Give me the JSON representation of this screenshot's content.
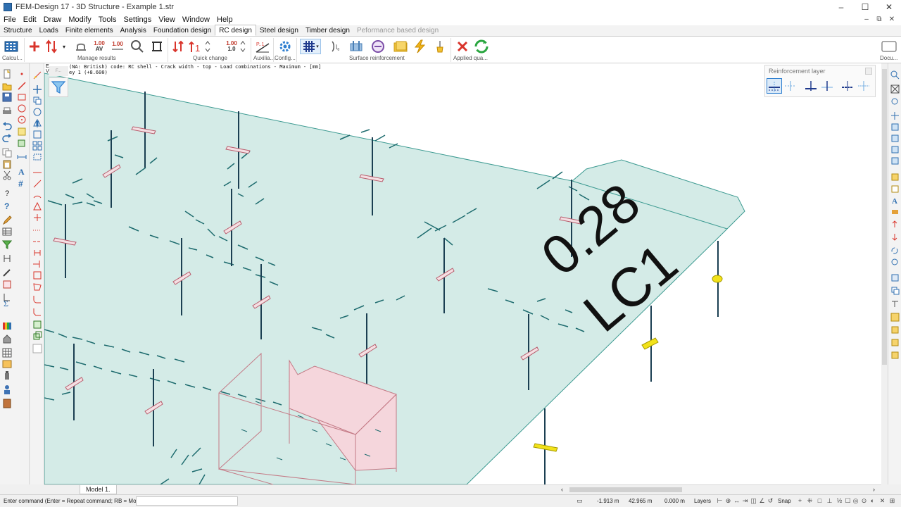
{
  "window": {
    "title": "FEM-Design 17 - 3D Structure - Example 1.str",
    "controls": [
      "–",
      "☐",
      "✕"
    ],
    "mdi_controls": [
      "–",
      "⧉",
      "✕"
    ]
  },
  "menu": [
    "File",
    "Edit",
    "Draw",
    "Modify",
    "Tools",
    "Settings",
    "View",
    "Window",
    "Help"
  ],
  "tabs": [
    {
      "label": "Structure",
      "state": "normal"
    },
    {
      "label": "Loads",
      "state": "normal"
    },
    {
      "label": "Finite elements",
      "state": "normal"
    },
    {
      "label": "Analysis",
      "state": "normal"
    },
    {
      "label": "Foundation design",
      "state": "normal"
    },
    {
      "label": "RC design",
      "state": "active"
    },
    {
      "label": "Steel design",
      "state": "normal"
    },
    {
      "label": "Timber design",
      "state": "normal"
    },
    {
      "label": "Peformance based design",
      "state": "disabled"
    }
  ],
  "ribbon": {
    "groups": [
      "Calcul...",
      "Manage results",
      "Quick change",
      "Auxilia...",
      "Config...",
      "Surface reinforcement",
      "Applied qua...",
      "Docu..."
    ],
    "labels": {
      "num_a": "1.00",
      "num_b": "1.00",
      "num_c": "1.00",
      "num_d": "1.00",
      "num_e": "1.0",
      "num_f": "1",
      "delta_ab": "AV",
      "p1": "P..1"
    }
  },
  "viewport": {
    "corner_letter_e": "E",
    "corner_letter_v": "V",
    "info_line1": "(NA: British) code: RC shell - Crack width - top - Load combinations - Maximum - [mm]",
    "info_line2": "ey 1 (+8.600)",
    "mini_tag": "F...",
    "result_value": "0.28",
    "result_case": "LC1",
    "colors": {
      "slab_fill": "#d4ebe7",
      "slab_edge": "#3c9a91",
      "column": "#1b3f52",
      "crack_dash": "#1d6b6e",
      "wall": "#c47a86",
      "wall_fill": "#f5d6dc",
      "support_yellow": "#f2e21a"
    }
  },
  "reinforcement_panel": {
    "title": "Reinforcement layer"
  },
  "model_tab": "Model 1.",
  "statusbar": {
    "command_prompt": "Enter command (Enter = Repeat command; RB = Modify):",
    "x": "-1.913 m",
    "y": "42.965 m",
    "z": "0.000 m",
    "layers": "Layers",
    "snap": "Snap"
  }
}
